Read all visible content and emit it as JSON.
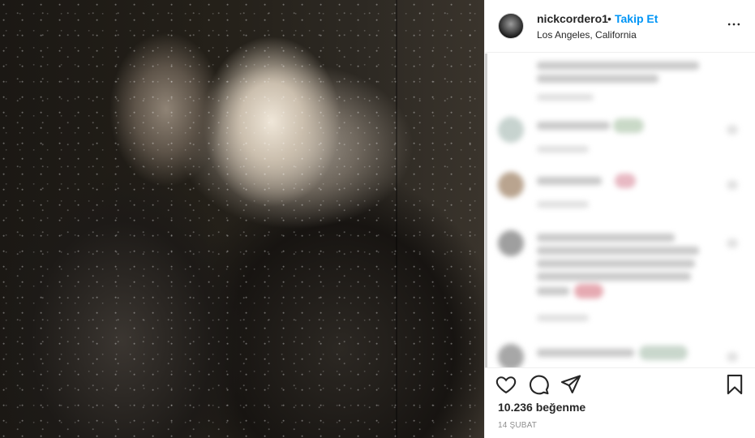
{
  "post": {
    "username": "nickcordero1",
    "separator": "•",
    "follow_label": "Takip Et",
    "location": "Los Angeles, California",
    "likes_text": "10.236 beğenme",
    "date_text": "14 ŞUBAT"
  },
  "icons": {
    "more": "more-options-icon",
    "like": "heart-icon",
    "comment": "comment-icon",
    "share": "paper-plane-icon",
    "save": "bookmark-icon"
  },
  "colors": {
    "accent": "#0095f6",
    "text": "#262626",
    "muted": "#8e8e8e",
    "border": "#efefef"
  }
}
